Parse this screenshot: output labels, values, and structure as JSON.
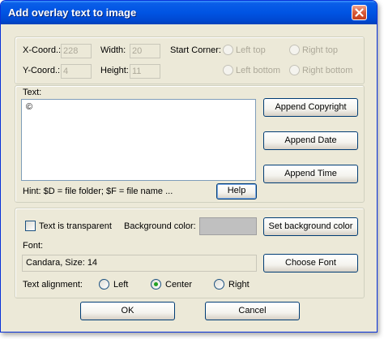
{
  "window": {
    "title": "Add overlay text to image"
  },
  "position": {
    "x_label": "X-Coord.:",
    "x_value": "228",
    "y_label": "Y-Coord.:",
    "y_value": "4",
    "width_label": "Width:",
    "width_value": "20",
    "height_label": "Height:",
    "height_value": "11",
    "start_corner_label": "Start Corner:",
    "corners": {
      "left_top": "Left top",
      "right_top": "Right top",
      "left_bottom": "Left bottom",
      "right_bottom": "Right bottom"
    }
  },
  "text_section": {
    "label": "Text:",
    "value": "©",
    "append_copyright": "Append Copyright",
    "append_date": "Append Date",
    "append_time": "Append Time",
    "hint": "Hint: $D = file folder; $F = file name ...",
    "help": "Help"
  },
  "style_section": {
    "transparent_label": "Text is transparent",
    "transparent_checked": false,
    "bg_color_label": "Background color:",
    "bg_color_value": "#c0c0c0",
    "set_bg_button": "Set background color",
    "font_label": "Font:",
    "font_value": "Candara, Size: 14",
    "choose_font": "Choose Font",
    "alignment_label": "Text alignment:",
    "alignment_options": {
      "left": "Left",
      "center": "Center",
      "right": "Right"
    },
    "alignment_selected": "center"
  },
  "footer": {
    "ok": "OK",
    "cancel": "Cancel"
  }
}
